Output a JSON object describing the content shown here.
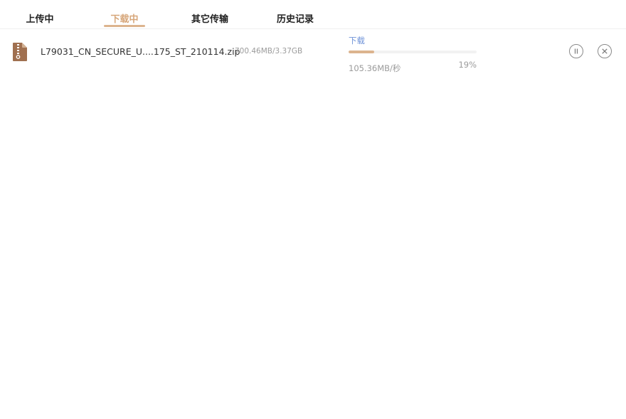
{
  "tabs": [
    {
      "label": "上传中",
      "active": false
    },
    {
      "label": "下载中",
      "active": true
    },
    {
      "label": "其它传输",
      "active": false
    },
    {
      "label": "历史记录",
      "active": false
    }
  ],
  "task": {
    "icon": "zip-file-icon",
    "file_name": "L79031_CN_SECURE_U....175_ST_210114.zip",
    "size": "700.46MB/3.37GB",
    "status": "下载",
    "speed": "105.36MB/秒",
    "percent_label": "19%",
    "progress": 0.2
  },
  "actions": {
    "pause_icon": "pause-icon",
    "cancel_icon": "close-icon"
  },
  "colors": {
    "accent": "#dcb48e",
    "active_tab_text": "#d7a77b",
    "status_text": "#6f93d8",
    "file_icon": "#a07050"
  }
}
